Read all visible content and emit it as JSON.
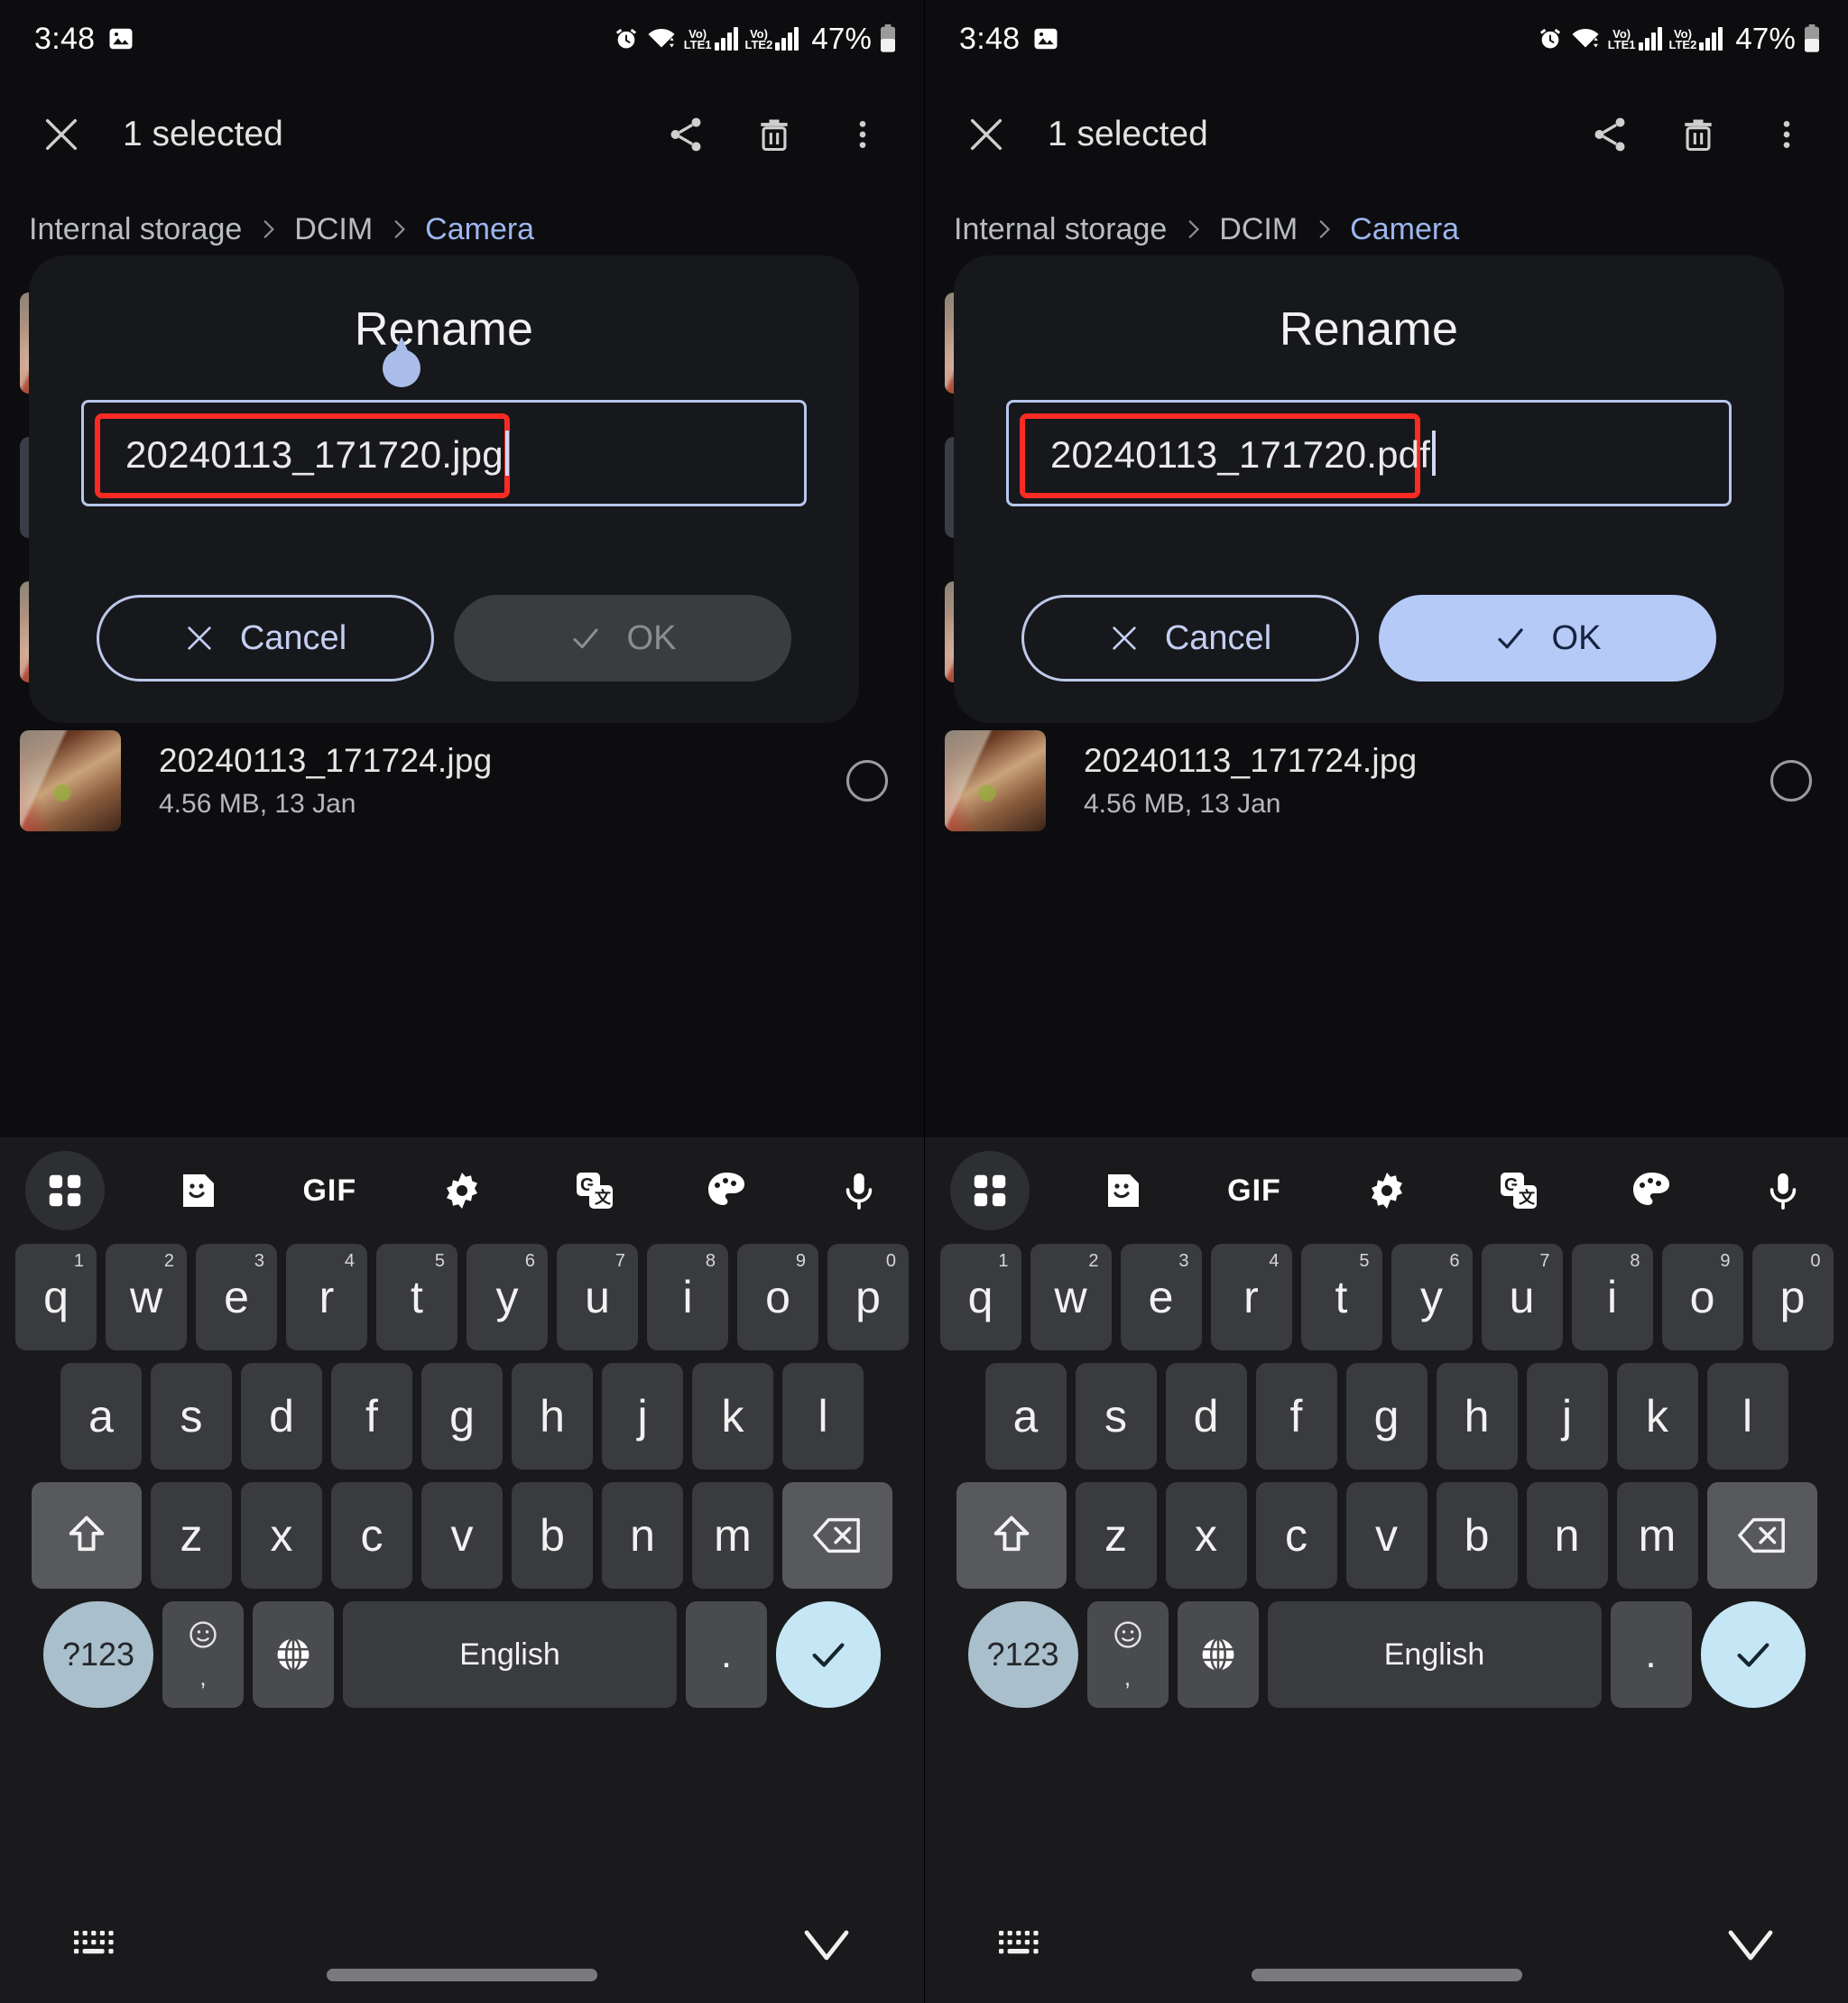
{
  "status_bar": {
    "time": "3:48",
    "image_icon": "image-icon",
    "alarm_icon": "alarm-icon",
    "wifi_icon": "wifi-icon",
    "sim1_label_top": "Vo)",
    "sim1_label_bottom": "LTE1",
    "sim2_label_top": "Vo)",
    "sim2_label_bottom": "LTE2",
    "battery_percent": "47%",
    "battery_icon": "battery-icon"
  },
  "action_bar": {
    "close_icon": "close-icon",
    "title": "1 selected",
    "share_icon": "share-icon",
    "delete_icon": "trash-icon",
    "overflow_icon": "more-vertical-icon"
  },
  "breadcrumb": {
    "items": [
      {
        "label": "Internal storage",
        "active": false
      },
      {
        "label": "DCIM",
        "active": false
      },
      {
        "label": "Camera",
        "active": true
      }
    ],
    "separator_icon": "chevron-right-icon"
  },
  "file_list": {
    "hidden_row_meta": "4.56 MB, 13 Jan",
    "rows": [
      {
        "name": "20240113_171724.jpg",
        "meta": "4.56 MB, 13 Jan",
        "thumbnail": "photo-thumbnail",
        "selector_icon": "radio-unselected-icon"
      }
    ]
  },
  "dialogs": {
    "left": {
      "title": "Rename",
      "input_value": "20240113_171720.jpg",
      "cancel_label": "Cancel",
      "cancel_icon": "close-icon",
      "ok_label": "OK",
      "ok_icon": "check-icon",
      "ok_enabled": false,
      "drag_handle_icon": "text-cursor-handle"
    },
    "right": {
      "title": "Rename",
      "input_value": "20240113_171720.pdf",
      "cancel_label": "Cancel",
      "cancel_icon": "close-icon",
      "ok_label": "OK",
      "ok_icon": "check-icon",
      "ok_enabled": true
    }
  },
  "keyboard": {
    "toolbar": [
      {
        "icon": "apps-grid-icon",
        "selected": true
      },
      {
        "icon": "sticker-icon",
        "selected": false
      },
      {
        "icon": "gif-icon",
        "label": "GIF",
        "selected": false
      },
      {
        "icon": "gear-icon",
        "selected": false
      },
      {
        "icon": "translate-icon",
        "selected": false
      },
      {
        "icon": "palette-icon",
        "selected": false
      },
      {
        "icon": "microphone-icon",
        "selected": false
      }
    ],
    "row1": [
      {
        "key": "q",
        "sup": "1"
      },
      {
        "key": "w",
        "sup": "2"
      },
      {
        "key": "e",
        "sup": "3"
      },
      {
        "key": "r",
        "sup": "4"
      },
      {
        "key": "t",
        "sup": "5"
      },
      {
        "key": "y",
        "sup": "6"
      },
      {
        "key": "u",
        "sup": "7"
      },
      {
        "key": "i",
        "sup": "8"
      },
      {
        "key": "o",
        "sup": "9"
      },
      {
        "key": "p",
        "sup": "0"
      }
    ],
    "row2": [
      "a",
      "s",
      "d",
      "f",
      "g",
      "h",
      "j",
      "k",
      "l"
    ],
    "row3": [
      "z",
      "x",
      "c",
      "v",
      "b",
      "n",
      "m"
    ],
    "shift_icon": "shift-up-arrow-icon",
    "backspace_icon": "backspace-icon",
    "numeric_label": "?123",
    "emoji_icon": "emoji-comma-icon",
    "globe_icon": "globe-language-icon",
    "space_label": "English",
    "period_label": ".",
    "enter_icon": "check-enter-icon"
  },
  "nav_bar": {
    "keyboard_icon": "keyboard-toggle-icon",
    "dismiss_icon": "chevron-down-icon",
    "home_pill": "home-gesture-pill"
  },
  "colors": {
    "accent_blue": "#b6caf8",
    "highlight_red": "#fb2b24",
    "link_blue": "#9cb6ef",
    "panel_bg": "#0d0d0f",
    "dialog_bg": "#17181c",
    "keyboard_bg": "#1a1a1c"
  }
}
